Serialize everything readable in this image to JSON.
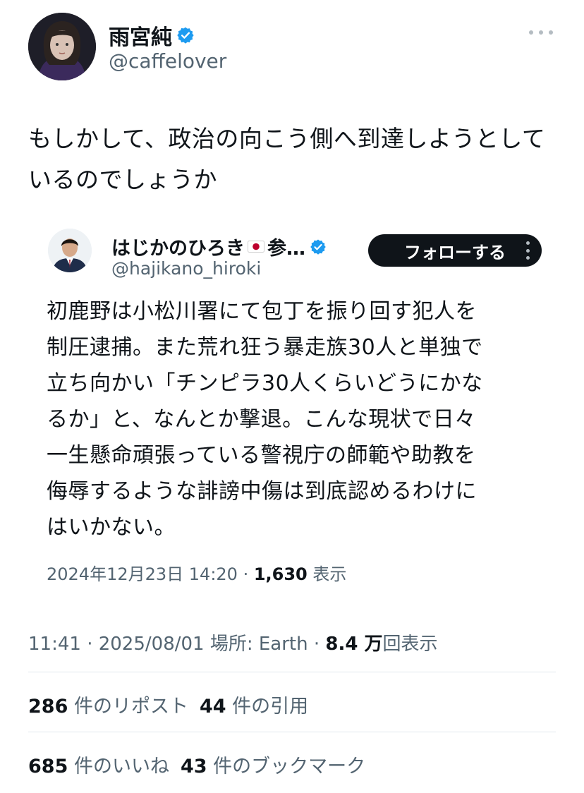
{
  "author": {
    "display_name": "雨宮純",
    "handle": "@caffelover"
  },
  "tweet": {
    "text": "もしかして、政治の向こう側へ到達しようとして\nいるのでしょうか"
  },
  "quoted": {
    "display_name": "はじかのひろき",
    "name_suffix": "参…",
    "handle": "@hajikano_hiroki",
    "follow_label": "フォローする",
    "text": "初鹿野は小松川署にて包丁を振り回す犯人を\n制圧逮捕。また荒れ狂う暴走族30人と単独で\n立ち向かい「チンピラ30人くらいどうにかな\nるか」と、なんとか撃退。こんな現状で日々\n一生懸命頑張っている警視庁の師範や助教を\n侮辱するような誹謗中傷は到底認めるわけに\nはいかない。",
    "timestamp": "2024年12月23日 14:20 · ",
    "views_count": "1,630",
    "views_label": " 表示"
  },
  "meta": {
    "time": "11:41 · 2025/08/01 場所: Earth · ",
    "views_count": "8.4 万",
    "views_label": "回表示"
  },
  "stats": {
    "reposts_count": "286",
    "reposts_label": "件のリポスト",
    "quotes_count": "44",
    "quotes_label": "件の引用",
    "likes_count": "685",
    "likes_label": "件のいいね",
    "bookmarks_count": "43",
    "bookmarks_label": "件のブックマーク"
  },
  "colors": {
    "verified_blue": "#1d9bf0",
    "secondary_text": "#536471",
    "follow_button_bg": "#0f1419"
  }
}
